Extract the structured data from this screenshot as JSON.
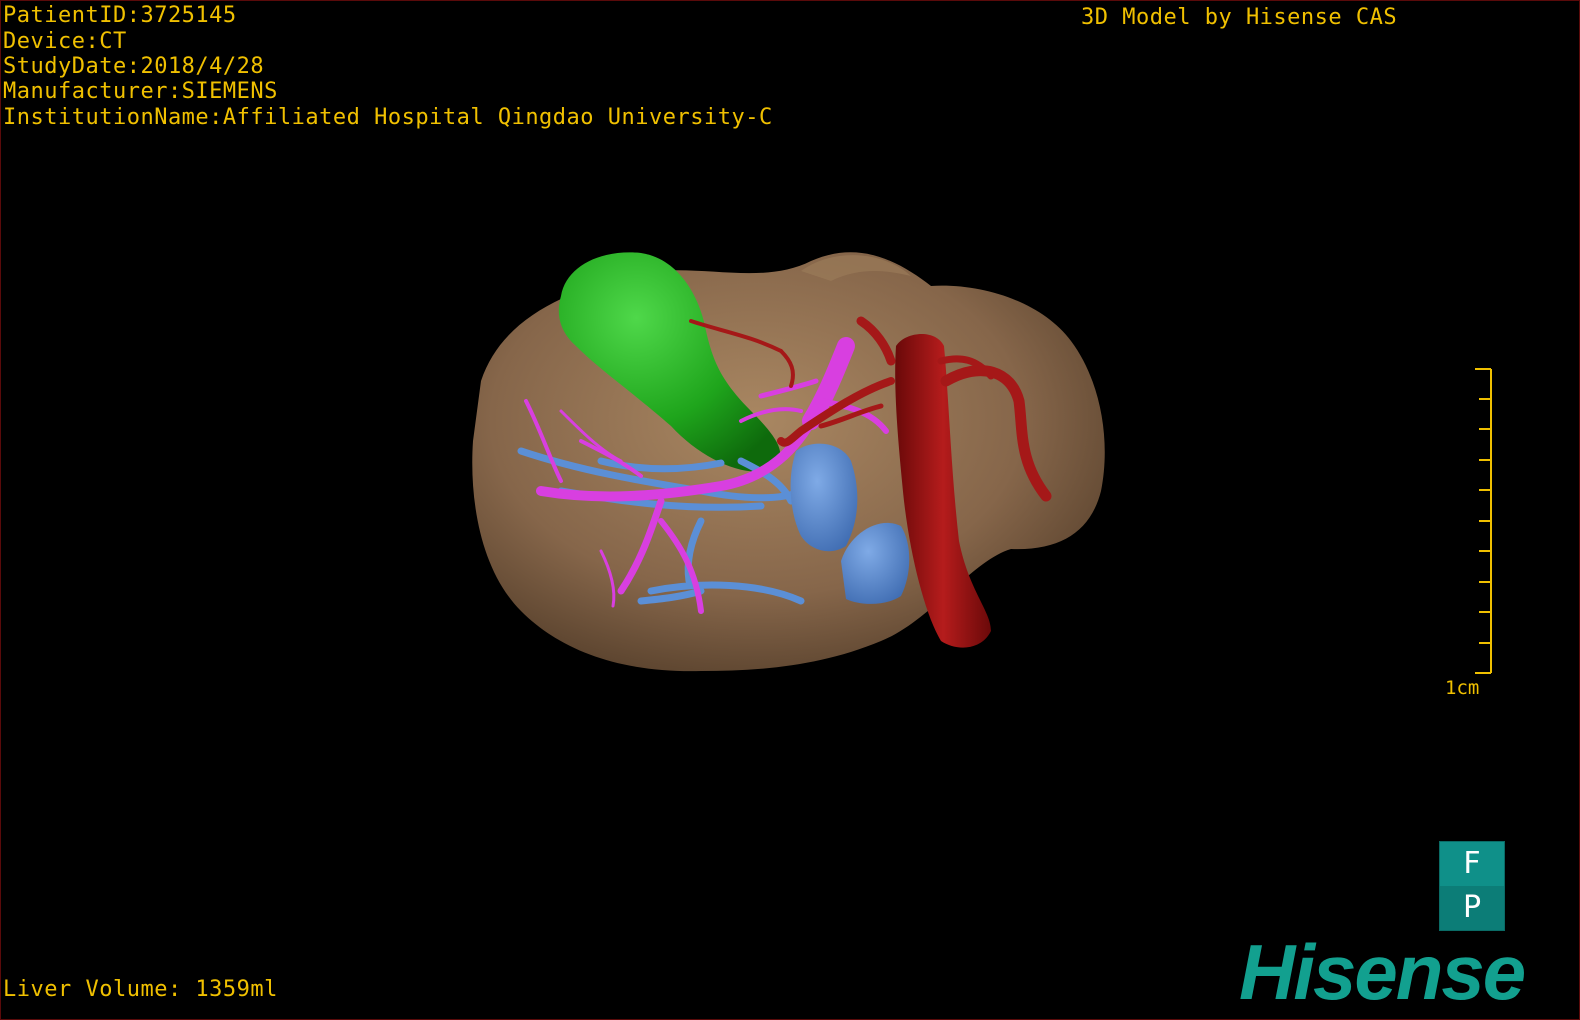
{
  "overlay": {
    "patient_id": "PatientID:3725145",
    "device": "Device:CT",
    "study_date": "StudyDate:2018/4/28",
    "manufacturer": "Manufacturer:SIEMENS",
    "institution": "InstitutionName:Affiliated Hospital Qingdao University-C",
    "credit": "3D Model by Hisense CAS",
    "liver_volume": "Liver Volume: 1359ml"
  },
  "scale": {
    "label": "1cm"
  },
  "orientation": {
    "top_face": "F",
    "bottom_face": "P"
  },
  "brand": {
    "name": "Hisense",
    "color": "#12a08f"
  },
  "colors": {
    "text": "#f0c000",
    "background": "#000000",
    "liver": "#8a6a48",
    "gallbladder": "#2fb52a",
    "portal_vein": "#d83fe0",
    "hepatic_vein": "#5b8fd6",
    "artery": "#a51818"
  }
}
